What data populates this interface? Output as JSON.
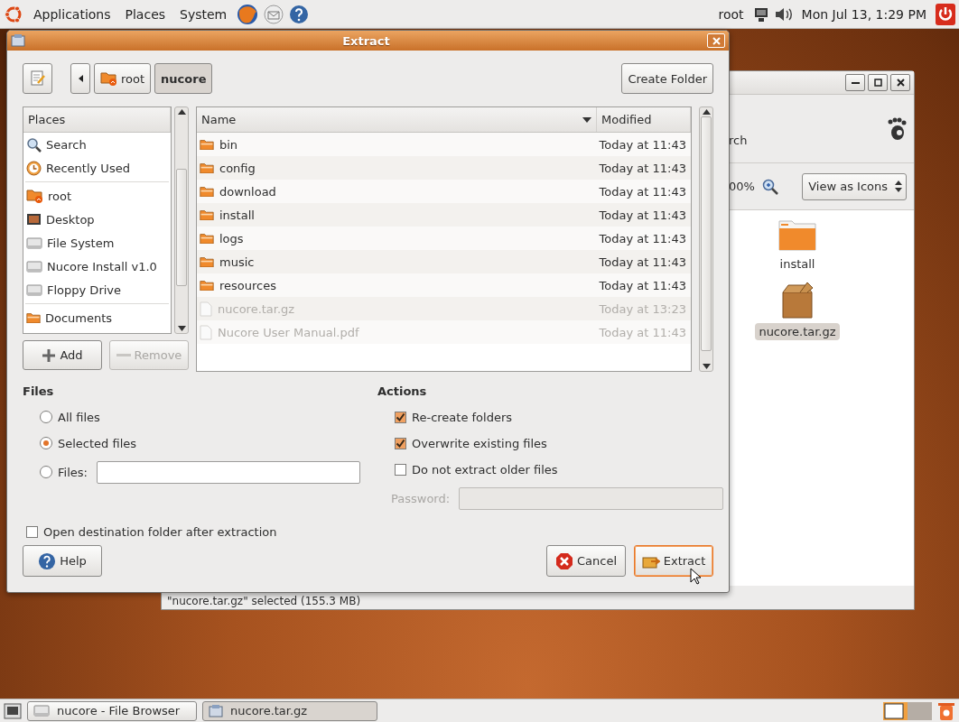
{
  "top_panel": {
    "menus": [
      "Applications",
      "Places",
      "System"
    ],
    "user": "root",
    "clock": "Mon Jul 13, 1:29 PM"
  },
  "file_browser": {
    "search_label": "rch",
    "zoom_level": "00%",
    "view_mode": "View as Icons",
    "status": "\"nucore.tar.gz\" selected (155.3 MB)",
    "icons": [
      {
        "label": "install",
        "kind": "folder",
        "selected": false
      },
      {
        "label": "nucore.tar.gz",
        "kind": "archive",
        "selected": true
      }
    ]
  },
  "dialog": {
    "title": "Extract",
    "create_folder": "Create Folder",
    "path": [
      {
        "label": "root",
        "selected": false
      },
      {
        "label": "nucore",
        "selected": true
      }
    ],
    "places": {
      "header": "Places",
      "groups": [
        [
          {
            "label": "Search",
            "kind": "search"
          },
          {
            "label": "Recently Used",
            "kind": "recent"
          }
        ],
        [
          {
            "label": "root",
            "kind": "home"
          },
          {
            "label": "Desktop",
            "kind": "desktop"
          },
          {
            "label": "File System",
            "kind": "drive"
          },
          {
            "label": "Nucore Install v1.0",
            "kind": "drive"
          },
          {
            "label": "Floppy Drive",
            "kind": "drive"
          }
        ],
        [
          {
            "label": "Documents",
            "kind": "folder"
          }
        ]
      ]
    },
    "add": {
      "label": "Add",
      "disabled": false
    },
    "remove": {
      "label": "Remove",
      "disabled": true
    },
    "columns": [
      "Name",
      "Modified"
    ],
    "files": [
      {
        "name": "bin",
        "modified": "Today at 11:43",
        "kind": "folder",
        "disabled": false
      },
      {
        "name": "config",
        "modified": "Today at 11:43",
        "kind": "folder",
        "disabled": false
      },
      {
        "name": "download",
        "modified": "Today at 11:43",
        "kind": "folder",
        "disabled": false
      },
      {
        "name": "install",
        "modified": "Today at 11:43",
        "kind": "folder",
        "disabled": false
      },
      {
        "name": "logs",
        "modified": "Today at 11:43",
        "kind": "folder",
        "disabled": false
      },
      {
        "name": "music",
        "modified": "Today at 11:43",
        "kind": "folder",
        "disabled": false
      },
      {
        "name": "resources",
        "modified": "Today at 11:43",
        "kind": "folder",
        "disabled": false
      },
      {
        "name": "nucore.tar.gz",
        "modified": "Today at 13:23",
        "kind": "file",
        "disabled": true
      },
      {
        "name": "Nucore User Manual.pdf",
        "modified": "Today at 11:43",
        "kind": "file",
        "disabled": true
      }
    ],
    "files_section": {
      "title": "Files",
      "options": [
        {
          "label": "All files",
          "selected": false,
          "kind": "plain"
        },
        {
          "label": "Selected files",
          "selected": true,
          "kind": "plain"
        },
        {
          "label": "Files:",
          "selected": false,
          "kind": "field"
        }
      ]
    },
    "actions_section": {
      "title": "Actions",
      "options": [
        {
          "label": "Re-create folders",
          "checked": true
        },
        {
          "label": "Overwrite existing files",
          "checked": true
        },
        {
          "label": "Do not extract older files",
          "checked": false
        }
      ],
      "password": {
        "label": "Password:",
        "disabled": true
      }
    },
    "open_destination": {
      "label": "Open destination folder after extraction",
      "checked": false
    },
    "buttons": {
      "help": "Help",
      "cancel": "Cancel",
      "extract": "Extract"
    }
  },
  "taskbar": [
    {
      "label": "nucore - File Browser",
      "selected": false,
      "kind": "browser"
    },
    {
      "label": "nucore.tar.gz",
      "selected": true,
      "kind": "archive"
    }
  ]
}
